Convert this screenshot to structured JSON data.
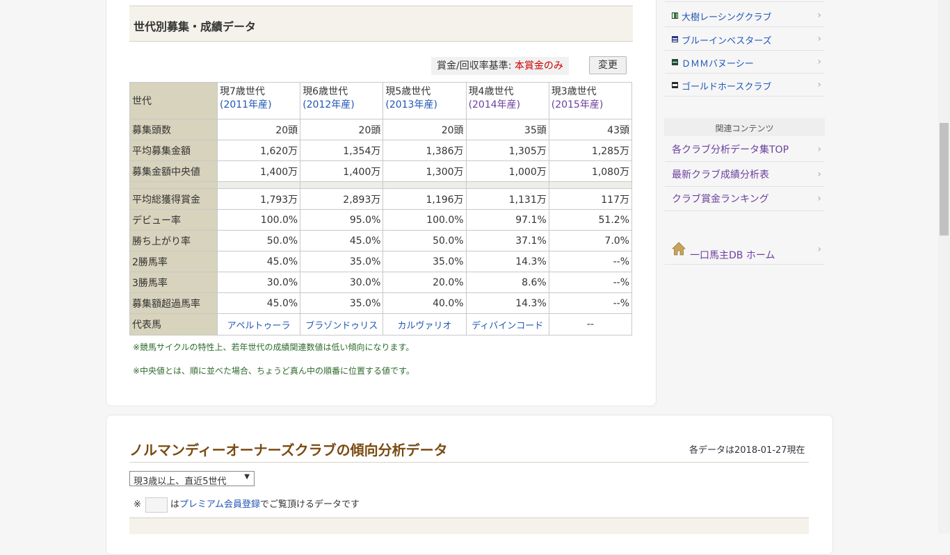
{
  "section_title": "世代別募集・成績データ",
  "basis": {
    "label": "賞金/回収率基準:",
    "value": "本賞金のみ",
    "button": "変更"
  },
  "table": {
    "header_label": "世代",
    "generations": [
      {
        "name": "現7歳世代",
        "year": "(2011年産)"
      },
      {
        "name": "現6歳世代",
        "year": "(2012年産)"
      },
      {
        "name": "現5歳世代",
        "year": "(2013年産)"
      },
      {
        "name": "現4歳世代",
        "year": "(2014年産)"
      },
      {
        "name": "現3歳世代",
        "year": "(2015年産)"
      }
    ],
    "rows1": [
      {
        "label": "募集頭数",
        "values": [
          "20頭",
          "20頭",
          "20頭",
          "35頭",
          "43頭"
        ]
      },
      {
        "label": "平均募集金額",
        "values": [
          "1,620万",
          "1,354万",
          "1,386万",
          "1,305万",
          "1,285万"
        ]
      },
      {
        "label": "募集金額中央値",
        "values": [
          "1,400万",
          "1,400万",
          "1,300万",
          "1,000万",
          "1,080万"
        ]
      }
    ],
    "rows2": [
      {
        "label": "平均総獲得賞金",
        "values": [
          "1,793万",
          "2,893万",
          "1,196万",
          "1,131万",
          "117万"
        ]
      },
      {
        "label": "デビュー率",
        "values": [
          "100.0%",
          "95.0%",
          "100.0%",
          "97.1%",
          "51.2%"
        ]
      },
      {
        "label": "勝ち上がり率",
        "values": [
          "50.0%",
          "45.0%",
          "50.0%",
          "37.1%",
          "7.0%"
        ]
      },
      {
        "label": "2勝馬率",
        "values": [
          "45.0%",
          "35.0%",
          "35.0%",
          "14.3%",
          "--%"
        ]
      },
      {
        "label": "3勝馬率",
        "values": [
          "30.0%",
          "30.0%",
          "20.0%",
          "8.6%",
          "--%"
        ]
      },
      {
        "label": "募集額超過馬率",
        "values": [
          "45.0%",
          "35.0%",
          "40.0%",
          "14.3%",
          "--%"
        ]
      }
    ],
    "horse_row": {
      "label": "代表馬",
      "values": [
        "アペルトゥーラ",
        "ブラゾンドゥリス",
        "カルヴァリオ",
        "ディバインコード",
        "--"
      ]
    }
  },
  "notes": [
    "※競馬サイクルの特性上、若年世代の成績関連数値は低い傾向になります。",
    "※中央値とは、順に並べた場合、ちょうど真ん中の順番に位置する値です。"
  ],
  "sidebar": {
    "clubs": [
      {
        "label": "大樹レーシングクラブ",
        "flag_color": "#1a8a2a"
      },
      {
        "label": "ブルーインベスターズ",
        "flag_color": "#2233cc"
      },
      {
        "label": "ＤＭＭバヌーシー",
        "flag_color": "#1a5a3a"
      },
      {
        "label": "ゴールドホースクラブ",
        "flag_color": "#222222"
      }
    ],
    "related_heading": "関連コンテンツ",
    "related": [
      "各クラブ分析データ集TOP",
      "最新クラブ成績分析表",
      "クラブ賞金ランキング"
    ],
    "home": "一口馬主DB ホーム",
    "chevron": "›"
  },
  "trend": {
    "title": "ノルマンディーオーナーズクラブの傾向分析データ",
    "as_of": "各データは2018-01-27現在",
    "select_value": "現3歳以上、直近5世代",
    "premium_prefix": "※",
    "premium_link": "プレミアム会員登録",
    "premium_pre": "は",
    "premium_suffix": "でご覧頂けるデータです"
  }
}
